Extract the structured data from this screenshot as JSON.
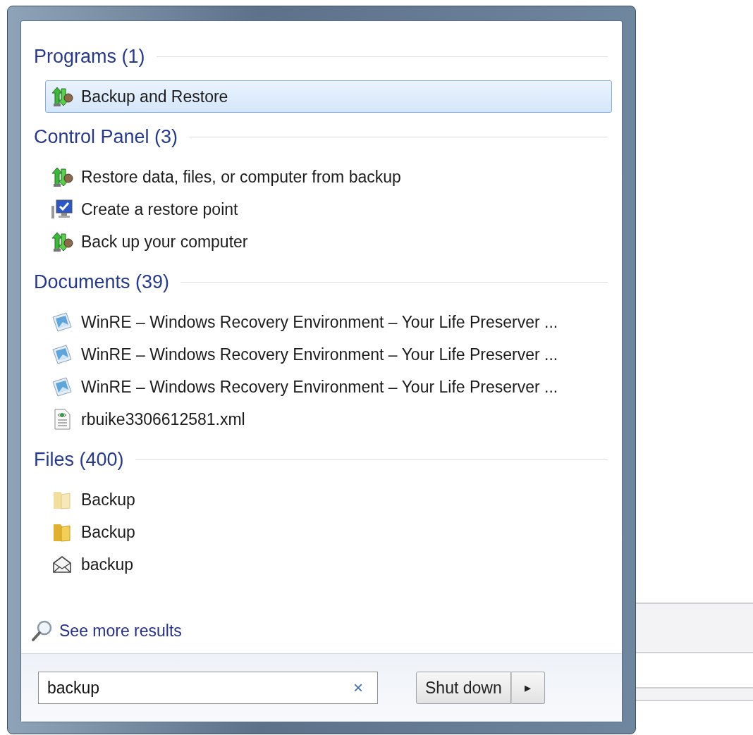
{
  "sections": [
    {
      "title": "Programs (1)",
      "items": [
        {
          "label": "Backup and Restore",
          "kind": "backup",
          "selected": true
        }
      ]
    },
    {
      "title": "Control Panel (3)",
      "items": [
        {
          "label": "Restore data, files, or computer from backup",
          "kind": "backup",
          "selected": false
        },
        {
          "label": "Create a restore point",
          "kind": "monitor",
          "selected": false
        },
        {
          "label": "Back up your computer",
          "kind": "backup",
          "selected": false
        }
      ]
    },
    {
      "title": "Documents (39)",
      "items": [
        {
          "label": "WinRE – Windows Recovery Environment – Your Life Preserver ...",
          "kind": "document",
          "selected": false
        },
        {
          "label": "WinRE – Windows Recovery Environment – Your Life Preserver ...",
          "kind": "document",
          "selected": false
        },
        {
          "label": "WinRE – Windows Recovery Environment – Your Life Preserver ...",
          "kind": "document",
          "selected": false
        },
        {
          "label": "rbuike3306612581.xml",
          "kind": "xml",
          "selected": false
        }
      ]
    },
    {
      "title": "Files (400)",
      "items": [
        {
          "label": "Backup",
          "kind": "folderpale",
          "selected": false
        },
        {
          "label": "Backup",
          "kind": "folder",
          "selected": false
        },
        {
          "label": "backup",
          "kind": "envelope",
          "selected": false
        }
      ]
    }
  ],
  "see_more": "See more results",
  "search": {
    "value": "backup",
    "clear": "×"
  },
  "shutdown": {
    "label": "Shut down",
    "arrow": "▸"
  }
}
